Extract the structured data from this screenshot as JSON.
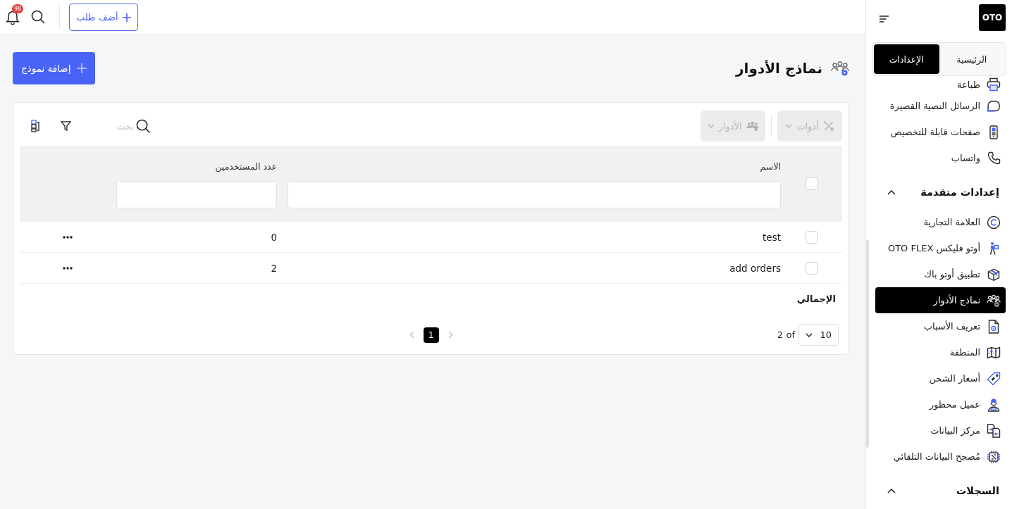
{
  "topbar": {
    "notification_count": "98",
    "add_order_button": "أضف طلب"
  },
  "sidebar": {
    "logo": "OTO",
    "tabs": [
      {
        "label": "الرئيسية",
        "selected": false
      },
      {
        "label": "الإعدادات",
        "selected": true
      }
    ],
    "items": [
      {
        "label": "طباعة",
        "selected": false
      },
      {
        "label": "الرسائل النصية القصيرة",
        "selected": false
      },
      {
        "label": "صفحات قابلة للتخصيص",
        "selected": false
      },
      {
        "label": "واتساب",
        "selected": false
      }
    ],
    "sections": [
      {
        "title": "إعدادات متقدمة",
        "expanded": true,
        "items": [
          {
            "label": "العلامة التجارية",
            "selected": false
          },
          {
            "label": "أوتو فليكس OTO FLEX",
            "selected": false
          },
          {
            "label": "تطبيق أوتو باك",
            "selected": false
          },
          {
            "label": "نماذج الأدوار",
            "selected": true
          },
          {
            "label": "تعريف الأسباب",
            "selected": false
          },
          {
            "label": "المنطقة",
            "selected": false
          },
          {
            "label": "أسعار الشحن",
            "selected": false
          },
          {
            "label": "عميل محظور",
            "selected": false
          },
          {
            "label": "مركز البيانات",
            "selected": false
          },
          {
            "label": "مُصجح البيانات التلقائي",
            "selected": false
          }
        ]
      },
      {
        "title": "السجلات",
        "expanded": true
      }
    ]
  },
  "page": {
    "title": "نماذج الأدوار",
    "add_button": "إضافة نموذج"
  },
  "toolbar": {
    "dropdowns": [
      {
        "label": "أدوات",
        "disabled": true
      },
      {
        "label": "الأدوار",
        "disabled": true
      }
    ],
    "search": {
      "placeholder": "بحث"
    }
  },
  "table": {
    "all_checked": false,
    "columns": [
      {
        "label": "الاسم"
      },
      {
        "label": "عدد المستخدمين"
      }
    ],
    "rows": [
      {
        "checked": false,
        "name": "test",
        "users": "0"
      },
      {
        "checked": false,
        "name": "add orders",
        "users": "2"
      }
    ]
  },
  "footer": {
    "total_label": "الإجمالي",
    "page_size": "10",
    "range_text": "2 of",
    "prev_disabled": true,
    "next_disabled": true,
    "pages": [
      {
        "label": "1",
        "selected": true
      }
    ]
  }
}
